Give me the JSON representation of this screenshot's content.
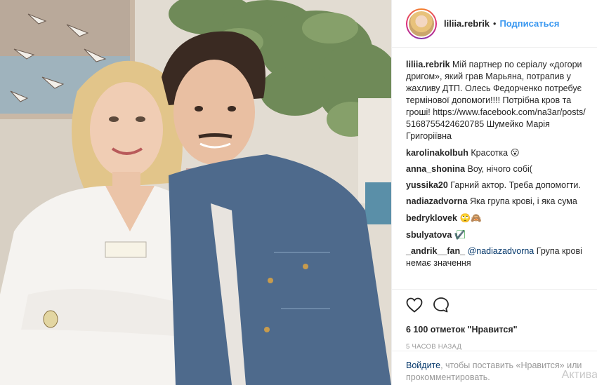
{
  "header": {
    "username": "liliia.rebrik",
    "separator": "•",
    "follow_label": "Подписаться"
  },
  "caption": {
    "username": "liliia.rebrik",
    "text": "Мій партнер по серіалу «догори дригом», який грав Марьяна, потрапив у жахливу ДТП. Олесь Федорченко потребує термінової допомоги!!!! Потрібна кров та гроші! https://www.facebook.com/na3ar/posts/ 5168755424620785 Шумейко Марія Григоріївна"
  },
  "comments": [
    {
      "username": "karolinakolbuh",
      "text": "Красотка",
      "emoji": "😮"
    },
    {
      "username": "anna_shonina",
      "text": "Воу, нічого собі("
    },
    {
      "username": "yussika20",
      "text": "Гарний актор. Треба допомогти."
    },
    {
      "username": "nadiazadvorna",
      "text": "Яка група крові, і яка сума"
    },
    {
      "username": "bedryklovek",
      "text": "",
      "emoji": "🙄🙈"
    },
    {
      "username": "sbulyatova",
      "text": "✔️⃞⃞"
    },
    {
      "username": "_andrik__fan_",
      "mention": "@nadiazadvorna",
      "text": "Група крові немає значення"
    }
  ],
  "actions": {
    "like_icon": "heart-icon",
    "comment_icon": "comment-icon",
    "likes_text": "6 100 отметок \"Нравится\"",
    "time_text": "5 часов назад"
  },
  "login": {
    "link_text": "Войдите",
    "rest_text": ", чтобы поставить «Нравится» или прокомментировать."
  },
  "watermark": "Актива",
  "colors": {
    "accent": "#3897f0",
    "link": "#003569",
    "muted": "#999999",
    "border": "#efefef"
  }
}
